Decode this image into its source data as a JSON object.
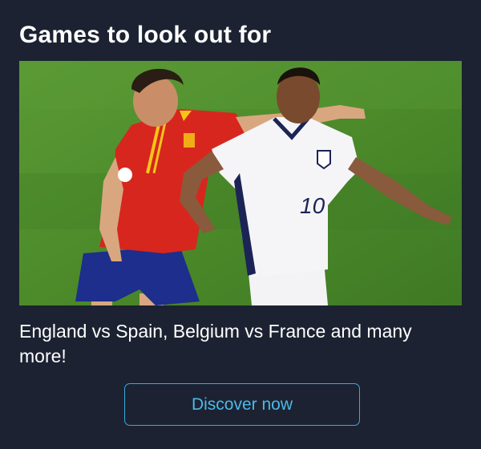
{
  "card": {
    "title": "Games to look out for",
    "description": "England vs Spain, Belgium vs France and many more!",
    "cta_label": "Discover now"
  },
  "image": {
    "player_number": "10"
  },
  "colors": {
    "background": "#1c2231",
    "accent": "#39a9dc",
    "pitch": "#4f8a2c"
  }
}
